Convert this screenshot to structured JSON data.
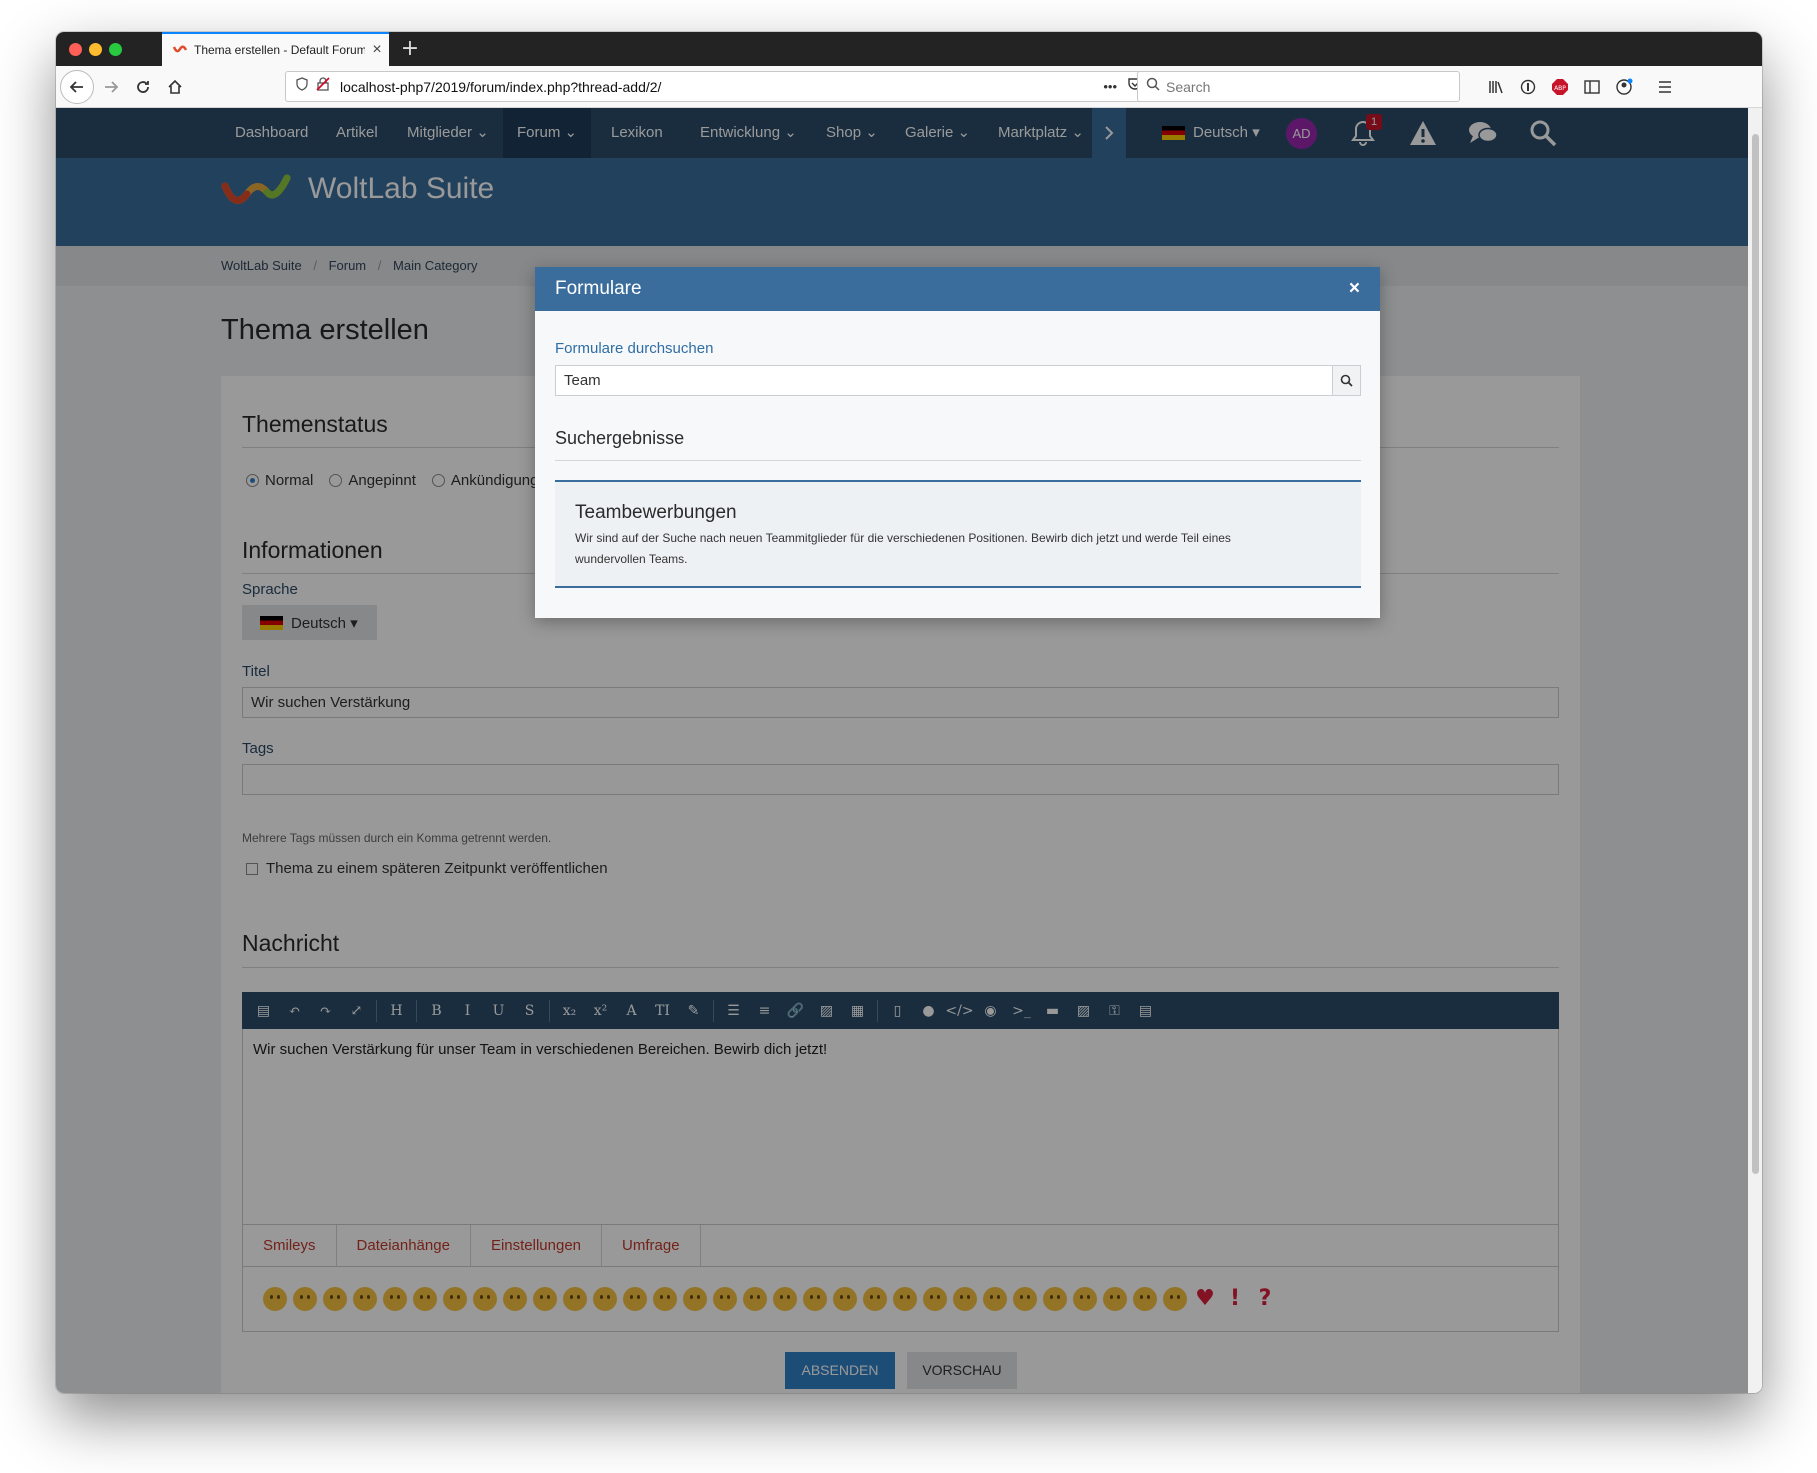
{
  "browser": {
    "tab_title": "Thema erstellen - Default Forum",
    "new_tab": "+",
    "url": "localhost-php7/2019/forum/index.php?thread-add/2/",
    "url_more": "•••",
    "search_placeholder": "Search"
  },
  "nav": {
    "items": [
      {
        "label": "Dashboard"
      },
      {
        "label": "Artikel"
      },
      {
        "label": "Mitglieder ⌄"
      },
      {
        "label": "Forum ⌄"
      },
      {
        "label": "Lexikon"
      },
      {
        "label": "Entwicklung ⌄"
      },
      {
        "label": "Shop ⌄"
      },
      {
        "label": "Galerie ⌄"
      },
      {
        "label": "Marktplatz ⌄"
      }
    ],
    "language": "Deutsch ▾",
    "avatar": "AD",
    "notification_count": "1"
  },
  "header": {
    "logo_text": "WoltLab Suite"
  },
  "breadcrumb": {
    "items": [
      "WoltLab Suite",
      "Forum",
      "Main Category"
    ],
    "separator": "/"
  },
  "page": {
    "title": "Thema erstellen"
  },
  "form": {
    "status_title": "Themenstatus",
    "status_options": [
      "Normal",
      "Angepinnt",
      "Ankündigung"
    ],
    "info_title": "Informationen",
    "language_label": "Sprache",
    "language_value": "Deutsch ▾",
    "title_label": "Titel",
    "title_value": "Wir suchen Verstärkung",
    "tags_label": "Tags",
    "tags_value": "",
    "tags_help": "Mehrere Tags müssen durch ein Komma getrennt werden.",
    "schedule_label": "Thema zu einem späteren Zeitpunkt veröffentlichen",
    "message_title": "Nachricht",
    "message_text": "Wir suchen Verstärkung für unser Team in verschiedenen Bereichen. Bewirb dich jetzt!",
    "editor_tabs": [
      "Smileys",
      "Dateianhänge",
      "Einstellungen",
      "Umfrage"
    ],
    "submit_label": "ABSENDEN",
    "preview_label": "VORSCHAU"
  },
  "editor_toolbar": {
    "buttons": [
      "▤",
      "↶",
      "↷",
      "⤢",
      "|",
      "H",
      "|",
      "B",
      "I",
      "U",
      "S",
      "|",
      "x₂",
      "x²",
      "A",
      "TI",
      "✎",
      "|",
      "☰",
      "≡",
      "🔗",
      "▨",
      "▦",
      "|",
      "▯",
      "●",
      "</>",
      "◉",
      ">_",
      "▬",
      "▨",
      "⚿",
      "▤"
    ]
  },
  "dialog": {
    "title": "Formulare",
    "close": "×",
    "search_label": "Formulare durchsuchen",
    "search_value": "Team",
    "results_title": "Suchergebnisse",
    "result": {
      "title": "Teambewerbungen",
      "description": "Wir sind auf der Suche nach neuen Teammitglieder für die verschiedenen Positionen. Bewirb dich jetzt und werde Teil eines wundervollen Teams."
    }
  },
  "colors": {
    "nav_bg": "#2a4b6a",
    "header_bg": "#3a6d9c",
    "accent": "#2f80c7",
    "link_red": "#c0392b"
  }
}
